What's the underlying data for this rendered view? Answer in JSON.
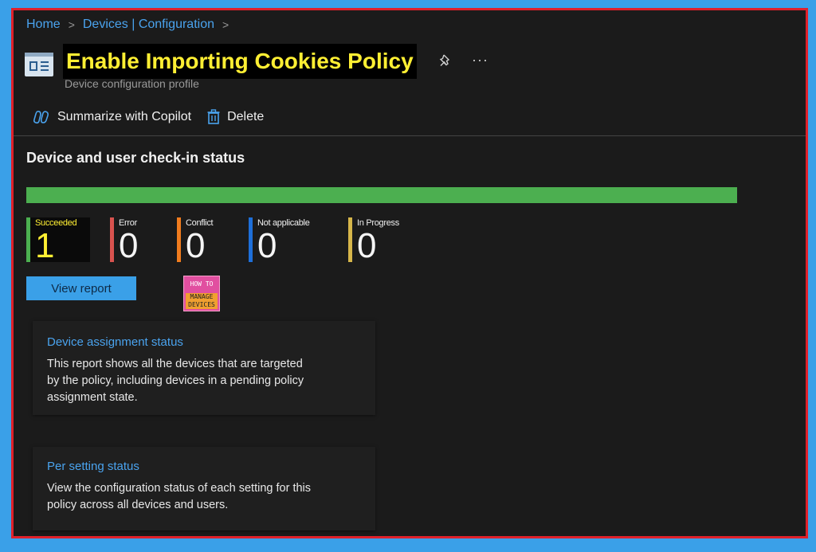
{
  "breadcrumb": {
    "items": [
      "Home",
      "Devices | Configuration"
    ],
    "separator": ">"
  },
  "header": {
    "title": "Enable Importing Cookies Policy",
    "subtitle": "Device configuration profile",
    "more_label": "···"
  },
  "toolbar": {
    "summarize_label": "Summarize with Copilot",
    "delete_label": "Delete"
  },
  "checkin": {
    "title": "Device and user check-in status",
    "progress_fraction": 1.0,
    "progress_color": "#4caf50",
    "stats": [
      {
        "label": "Succeeded",
        "value": "1",
        "color": "#4caf50"
      },
      {
        "label": "Error",
        "value": "0",
        "color": "#d9534f"
      },
      {
        "label": "Conflict",
        "value": "0",
        "color": "#f07c1e"
      },
      {
        "label": "Not applicable",
        "value": "0",
        "color": "#1e6fd9"
      },
      {
        "label": "In Progress",
        "value": "0",
        "color": "#d6b64a"
      }
    ],
    "view_report_label": "View report"
  },
  "logo": {
    "line1": "HOW TO",
    "line2": "MANAGE",
    "line3": "DEVICES"
  },
  "cards": [
    {
      "title": "Device assignment status",
      "description": "This report shows all the devices that are targeted by the policy, including devices in a pending policy assignment state."
    },
    {
      "title": "Per setting status",
      "description": "View the configuration status of each setting for this policy across all devices and users."
    }
  ]
}
